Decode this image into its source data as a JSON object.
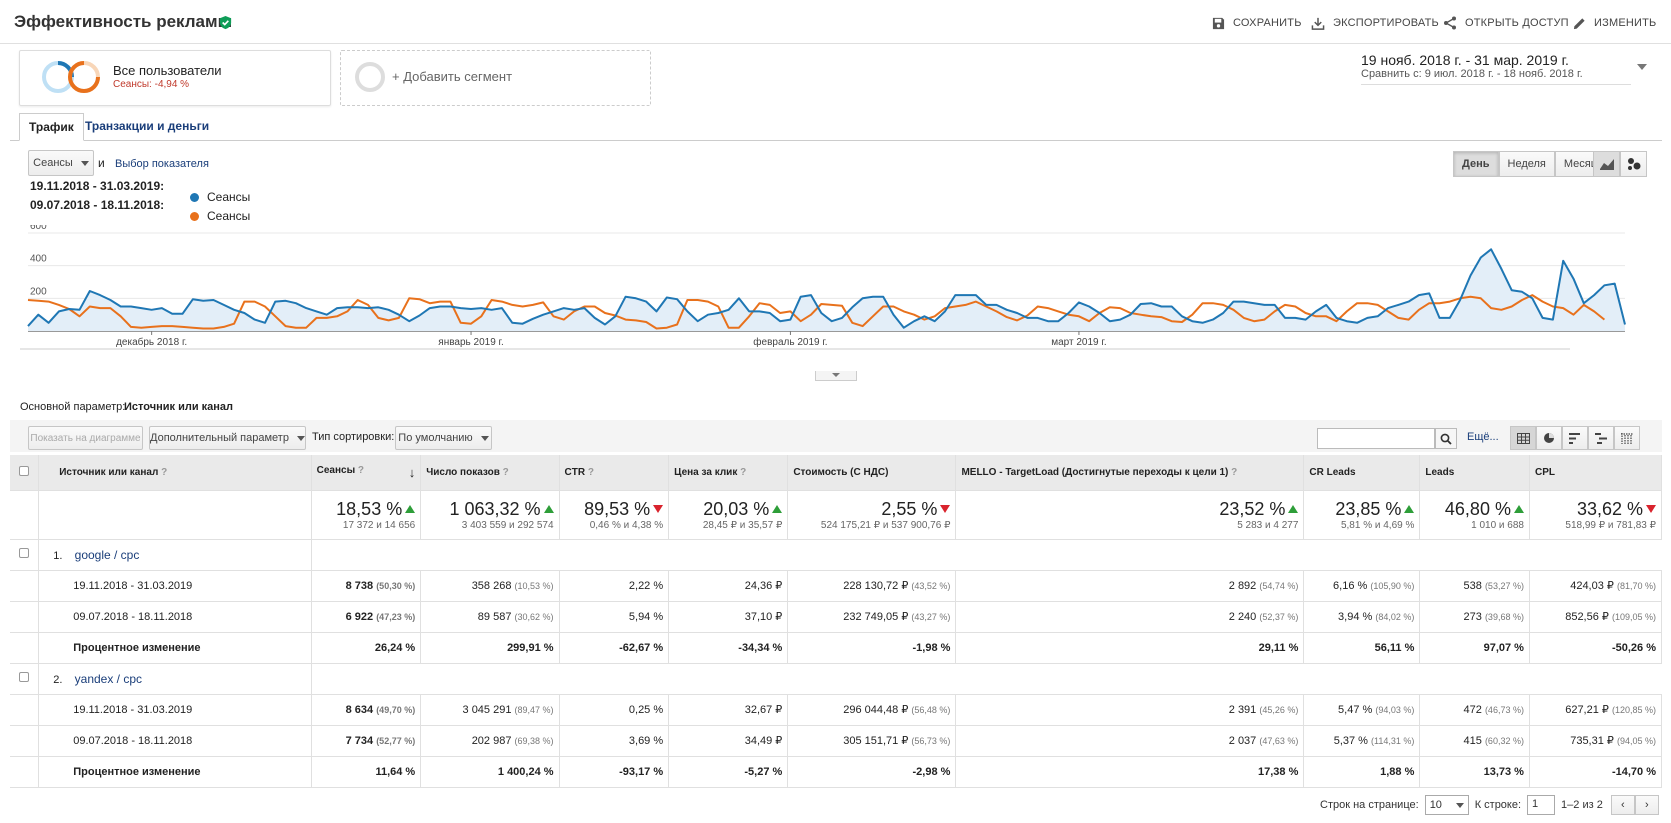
{
  "header": {
    "title": "Эффективность рекламы",
    "actions": {
      "save": "СОХРАНИТЬ",
      "export": "ЭКСПОРТИРОВАТЬ",
      "share": "ОТКРЫТЬ ДОСТУП",
      "edit": "ИЗМЕНИТЬ"
    }
  },
  "segments": {
    "active": {
      "name": "Все пользователи",
      "sub": "Сеансы: -4,94 %"
    },
    "add_label": "+ Добавить сегмент"
  },
  "date_range": {
    "main": "19 нояб. 2018 г. - 31 мар. 2019 г.",
    "compare_label": "Сравнить с:",
    "compare": "9 июл. 2018 г. - 18 нояб. 2018 г."
  },
  "tabs": [
    "Трафик",
    "Транзакции и деньги"
  ],
  "chart_controls": {
    "metric": "Сеансы",
    "and": "и",
    "metric_chooser": "Выбор показателя",
    "periods": [
      "День",
      "Неделя",
      "Месяц"
    ],
    "active_period": "День"
  },
  "legend": [
    {
      "range": "19.11.2018 - 31.03.2019:",
      "name": "Сеансы",
      "color": "#1f77b4"
    },
    {
      "range": "09.07.2018 - 18.11.2018:",
      "name": "Сеансы",
      "color": "#e8711c"
    }
  ],
  "chart_data": {
    "type": "line",
    "ylim": [
      0,
      600
    ],
    "y_ticks": [
      "600",
      "400",
      "200"
    ],
    "x_tick_labels": [
      "декабрь 2018 г.",
      "январь 2019 г.",
      "февраль 2019 г.",
      "март 2019 г."
    ],
    "x_tick_days": [
      12,
      43,
      74,
      102
    ],
    "series": [
      {
        "name": "Сеансы",
        "range": "19.11.2018 - 31.03.2019",
        "color": "#1f77b4",
        "values": [
          30,
          100,
          50,
          120,
          135,
          130,
          245,
          220,
          190,
          150,
          150,
          140,
          130,
          140,
          105,
          105,
          195,
          185,
          190,
          160,
          130,
          110,
          70,
          50,
          180,
          185,
          170,
          140,
          120,
          100,
          140,
          145,
          145,
          140,
          145,
          130,
          100,
          60,
          95,
          140,
          150,
          150,
          140,
          135,
          140,
          130,
          140,
          50,
          45,
          75,
          100,
          120,
          140,
          130,
          140,
          80,
          40,
          90,
          210,
          200,
          180,
          120,
          205,
          195,
          120,
          60,
          100,
          110,
          130,
          200,
          120,
          120,
          110,
          60,
          70,
          210,
          220,
          110,
          60,
          80,
          145,
          200,
          210,
          210,
          100,
          20,
          60,
          90,
          60,
          120,
          220,
          220,
          220,
          160,
          160,
          130,
          110,
          80,
          80,
          60,
          60,
          110,
          175,
          150,
          110,
          60,
          70,
          100,
          165,
          170,
          150,
          150,
          90,
          60,
          50,
          70,
          110,
          180,
          180,
          170,
          160,
          160,
          80,
          80,
          70,
          120,
          160,
          80,
          60,
          50,
          80,
          90,
          140,
          160,
          180,
          220,
          230,
          80,
          80,
          190,
          340,
          450,
          500,
          380,
          250,
          240,
          200,
          80,
          70,
          430,
          320,
          170,
          220,
          280,
          290,
          40
        ],
        "values_note": "Сеансы по дням"
      },
      {
        "name": "Сеансы",
        "range": "09.07.2018 - 18.11.2018",
        "color": "#e8711c",
        "values": [
          190,
          185,
          180,
          160,
          135,
          90,
          150,
          140,
          140,
          90,
          25,
          20,
          25,
          30,
          30,
          25,
          20,
          15,
          15,
          25,
          45,
          180,
          180,
          150,
          90,
          30,
          20,
          20,
          80,
          80,
          90,
          120,
          190,
          160,
          80,
          65,
          80,
          200,
          195,
          170,
          180,
          180,
          50,
          45,
          90,
          190,
          180,
          160,
          150,
          160,
          175,
          90,
          70,
          120,
          150,
          150,
          110,
          95,
          70,
          65,
          55,
          15,
          20,
          40,
          190,
          190,
          180,
          150,
          20,
          20,
          90,
          170,
          160,
          110,
          120,
          60,
          100,
          165,
          160,
          155,
          50,
          30,
          90,
          150,
          150,
          120,
          100,
          70,
          90,
          140,
          150,
          160,
          180,
          150,
          120,
          85,
          65,
          95,
          150,
          140,
          120,
          100,
          90,
          60,
          110,
          145,
          140,
          110,
          100,
          90,
          85,
          60,
          55,
          100,
          170,
          170,
          160,
          130,
          80,
          60,
          70,
          120,
          160,
          150,
          110,
          90,
          90,
          60,
          120,
          170,
          170,
          160,
          120,
          80,
          70,
          130,
          170,
          170,
          180,
          200,
          210,
          200,
          140,
          130,
          150,
          190,
          220,
          180,
          150,
          140,
          100,
          160,
          120,
          70
        ]
      }
    ]
  },
  "dimension": {
    "label": "Основной параметр:",
    "value": "Источник или канал"
  },
  "table_toolbar": {
    "plot_rows": "Показать на диаграмме",
    "secondary_dim": "Дополнительный параметр",
    "sort_label": "Тип сортировки:",
    "sort_value": "По умолчанию",
    "more": "Ещё..."
  },
  "table": {
    "columns": [
      "Источник или канал",
      "Сеансы",
      "Число показов",
      "CTR",
      "Цена за клик",
      "Стоимость (С НДС)",
      "MELLO - TargetLoad (Достигнутые переходы к цели 1)",
      "CR Leads",
      "Leads",
      "CPL"
    ],
    "totals": [
      {
        "main": "18,53 %",
        "dir": "up",
        "sub": "17 372 и 14 656"
      },
      {
        "main": "1 063,32 %",
        "dir": "up",
        "sub": "3 403 559 и 292 574"
      },
      {
        "main": "89,53 %",
        "dir": "down",
        "sub": "0,46 % и 4,38 %"
      },
      {
        "main": "20,03 %",
        "dir": "up",
        "sub": "28,45 ₽ и 35,57 ₽"
      },
      {
        "main": "2,55 %",
        "dir": "down",
        "sub": "524 175,21 ₽ и 537 900,76 ₽"
      },
      {
        "main": "23,52 %",
        "dir": "up",
        "sub": "5 283 и 4 277"
      },
      {
        "main": "23,85 %",
        "dir": "up",
        "sub": "5,81 % и 4,69 %"
      },
      {
        "main": "46,80 %",
        "dir": "up",
        "sub": "1 010 и 688"
      },
      {
        "main": "33,62 %",
        "dir": "down",
        "sub": "518,99 ₽ и 781,83 ₽"
      }
    ],
    "groups": [
      {
        "num": "1.",
        "name": "google / cpc",
        "rows": [
          {
            "label": "19.11.2018 - 31.03.2019",
            "cells": [
              [
                "8 738",
                "(50,30 %)"
              ],
              [
                "358 268",
                "(10,53 %)"
              ],
              [
                "2,22 %",
                ""
              ],
              [
                "24,36 ₽",
                ""
              ],
              [
                "228 130,72 ₽",
                "(43,52 %)"
              ],
              [
                "2 892",
                "(54,74 %)"
              ],
              [
                "6,16 %",
                "(105,90 %)"
              ],
              [
                "538",
                "(53,27 %)"
              ],
              [
                "424,03 ₽",
                "(81,70 %)"
              ]
            ]
          },
          {
            "label": "09.07.2018 - 18.11.2018",
            "cells": [
              [
                "6 922",
                "(47,23 %)"
              ],
              [
                "89 587",
                "(30,62 %)"
              ],
              [
                "5,94 %",
                ""
              ],
              [
                "37,10 ₽",
                ""
              ],
              [
                "232 749,05 ₽",
                "(43,27 %)"
              ],
              [
                "2 240",
                "(52,37 %)"
              ],
              [
                "3,94 %",
                "(84,02 %)"
              ],
              [
                "273",
                "(39,68 %)"
              ],
              [
                "852,56 ₽",
                "(109,05 %)"
              ]
            ]
          },
          {
            "label": "Процентное изменение",
            "bold": true,
            "cells": [
              [
                "26,24 %",
                ""
              ],
              [
                "299,91 %",
                ""
              ],
              [
                "-62,67 %",
                ""
              ],
              [
                "-34,34 %",
                ""
              ],
              [
                "-1,98 %",
                ""
              ],
              [
                "29,11 %",
                ""
              ],
              [
                "56,11 %",
                ""
              ],
              [
                "97,07 %",
                ""
              ],
              [
                "-50,26 %",
                ""
              ]
            ]
          }
        ]
      },
      {
        "num": "2.",
        "name": "yandex / cpc",
        "rows": [
          {
            "label": "19.11.2018 - 31.03.2019",
            "cells": [
              [
                "8 634",
                "(49,70 %)"
              ],
              [
                "3 045 291",
                "(89,47 %)"
              ],
              [
                "0,25 %",
                ""
              ],
              [
                "32,67 ₽",
                ""
              ],
              [
                "296 044,48 ₽",
                "(56,48 %)"
              ],
              [
                "2 391",
                "(45,26 %)"
              ],
              [
                "5,47 %",
                "(94,03 %)"
              ],
              [
                "472",
                "(46,73 %)"
              ],
              [
                "627,21 ₽",
                "(120,85 %)"
              ]
            ]
          },
          {
            "label": "09.07.2018 - 18.11.2018",
            "cells": [
              [
                "7 734",
                "(52,77 %)"
              ],
              [
                "202 987",
                "(69,38 %)"
              ],
              [
                "3,69 %",
                ""
              ],
              [
                "34,49 ₽",
                ""
              ],
              [
                "305 151,71 ₽",
                "(56,73 %)"
              ],
              [
                "2 037",
                "(47,63 %)"
              ],
              [
                "5,37 %",
                "(114,31 %)"
              ],
              [
                "415",
                "(60,32 %)"
              ],
              [
                "735,31 ₽",
                "(94,05 %)"
              ]
            ]
          },
          {
            "label": "Процентное изменение",
            "bold": true,
            "cells": [
              [
                "11,64 %",
                ""
              ],
              [
                "1 400,24 %",
                ""
              ],
              [
                "-93,17 %",
                ""
              ],
              [
                "-5,27 %",
                ""
              ],
              [
                "-2,98 %",
                ""
              ],
              [
                "17,38 %",
                ""
              ],
              [
                "1,88 %",
                ""
              ],
              [
                "13,73 %",
                ""
              ],
              [
                "-14,70 %",
                ""
              ]
            ]
          }
        ]
      }
    ]
  },
  "pager": {
    "rows_label": "Строк на странице:",
    "rows_value": "10",
    "goto_label": "К строке:",
    "goto_value": "1",
    "range": "1–2 из 2"
  }
}
